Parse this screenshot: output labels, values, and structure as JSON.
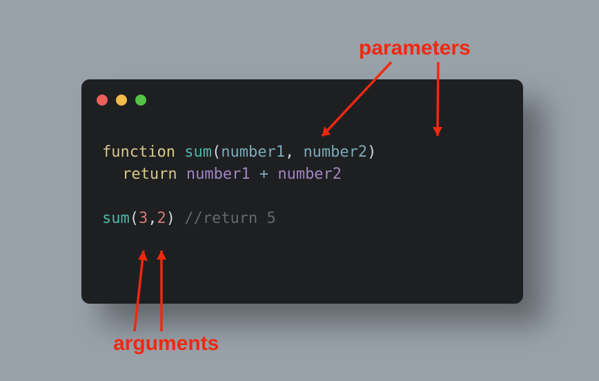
{
  "annotations": {
    "parameters_label": "parameters",
    "arguments_label": "arguments",
    "annotation_color": "#f02810"
  },
  "window": {
    "dots": [
      "red",
      "yellow",
      "green"
    ],
    "background": "#1e1f21"
  },
  "code": {
    "line1": {
      "keyword": "function",
      "funcName": "sum",
      "open": "(",
      "param1": "number1",
      "comma": ",",
      "param2": "number2",
      "close": ")"
    },
    "line2": {
      "keyword": "return",
      "var1": "number1",
      "op": "+",
      "var2": "number2"
    },
    "line4": {
      "funcName": "sum",
      "open": "(",
      "arg1": "3",
      "comma": ",",
      "arg2": "2",
      "close": ")",
      "comment": "//return 5"
    }
  },
  "syntax_colors": {
    "keyword": "#d7c988",
    "function": "#4fb8a9",
    "parameter": "#7babb8",
    "variable": "#a285c3",
    "operator": "#7babb8",
    "number": "#d27a78",
    "comment": "#63676f",
    "punctuation": "#d2d6dc"
  }
}
